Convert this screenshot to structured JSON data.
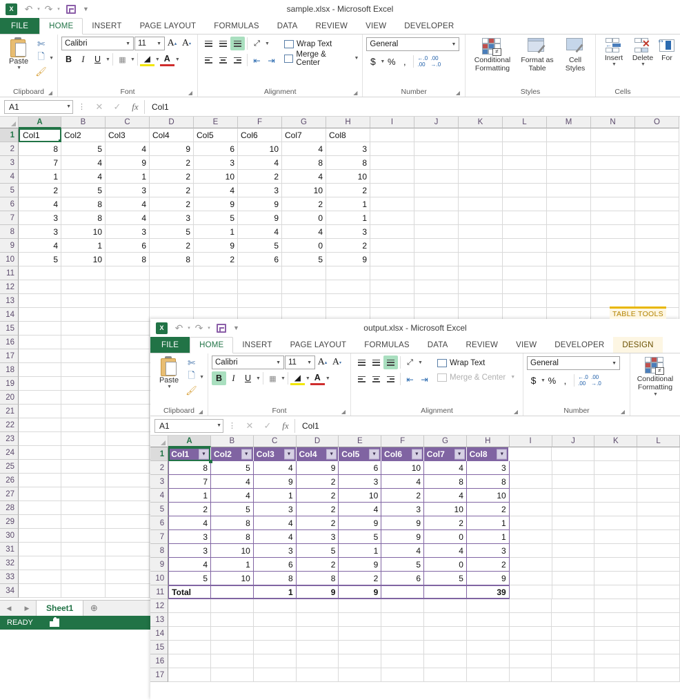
{
  "window1": {
    "title": "sample.xlsx - Microsoft Excel",
    "logo_text": "X",
    "quick_access": [
      "undo-icon",
      "redo-icon",
      "save-icon",
      "customize-icon"
    ],
    "tabs": [
      {
        "label": "FILE",
        "kind": "file"
      },
      {
        "label": "HOME",
        "kind": "active"
      },
      {
        "label": "INSERT",
        "kind": "normal"
      },
      {
        "label": "PAGE LAYOUT",
        "kind": "normal"
      },
      {
        "label": "FORMULAS",
        "kind": "normal"
      },
      {
        "label": "DATA",
        "kind": "normal"
      },
      {
        "label": "REVIEW",
        "kind": "normal"
      },
      {
        "label": "VIEW",
        "kind": "normal"
      },
      {
        "label": "DEVELOPER",
        "kind": "normal"
      }
    ],
    "ribbon": {
      "clipboard": {
        "label": "Clipboard",
        "paste": "Paste"
      },
      "font": {
        "label": "Font",
        "font_name": "Calibri",
        "font_size": "11",
        "bold": "B",
        "italic": "I",
        "underline": "U",
        "bold_active": false
      },
      "alignment": {
        "label": "Alignment",
        "wrap_text": "Wrap Text",
        "merge_center": "Merge & Center",
        "merge_disabled": false
      },
      "number": {
        "label": "Number",
        "format": "General",
        "currency": "$",
        "percent": "%",
        "comma": ","
      },
      "styles": {
        "label": "Styles",
        "conditional_formatting": "Conditional\nFormatting",
        "conditional_formatting_l1": "Conditional",
        "conditional_formatting_l2": "Formatting",
        "format_as_table_l1": "Format as",
        "format_as_table_l2": "Table",
        "cell_styles_l1": "Cell",
        "cell_styles_l2": "Styles"
      },
      "cells": {
        "label": "Cells",
        "insert": "Insert",
        "delete": "Delete",
        "format": "For"
      }
    },
    "formula_bar": {
      "name_box": "A1",
      "cancel": "✕",
      "enter": "✓",
      "fx": "fx",
      "content": "Col1"
    },
    "grid": {
      "columns": [
        "A",
        "B",
        "C",
        "D",
        "E",
        "F",
        "G",
        "H",
        "I",
        "J",
        "K",
        "L",
        "M",
        "N",
        "O"
      ],
      "selected_column": "A",
      "rows": [
        1,
        2,
        3,
        4,
        5,
        6,
        7,
        8,
        9,
        10,
        11,
        12,
        13,
        14,
        15,
        16,
        17,
        18,
        19,
        20,
        21,
        22,
        23,
        24,
        25,
        26,
        27,
        28,
        29,
        30,
        31,
        32,
        33,
        34
      ],
      "selected_row": 1,
      "active_cell": "A1"
    },
    "sheet_tabs": [
      "Sheet1"
    ],
    "status": "READY"
  },
  "window2": {
    "title": "output.xlsx - Microsoft Excel",
    "logo_text": "X",
    "context_banner": "TABLE TOOLS",
    "tabs": [
      {
        "label": "FILE",
        "kind": "file"
      },
      {
        "label": "HOME",
        "kind": "active"
      },
      {
        "label": "INSERT",
        "kind": "normal"
      },
      {
        "label": "PAGE LAYOUT",
        "kind": "normal"
      },
      {
        "label": "FORMULAS",
        "kind": "normal"
      },
      {
        "label": "DATA",
        "kind": "normal"
      },
      {
        "label": "REVIEW",
        "kind": "normal"
      },
      {
        "label": "VIEW",
        "kind": "normal"
      },
      {
        "label": "DEVELOPER",
        "kind": "normal"
      },
      {
        "label": "DESIGN",
        "kind": "ctx"
      }
    ],
    "ribbon": {
      "clipboard": {
        "label": "Clipboard",
        "paste": "Paste"
      },
      "font": {
        "label": "Font",
        "font_name": "Calibri",
        "font_size": "11",
        "bold": "B",
        "italic": "I",
        "underline": "U",
        "bold_active": true
      },
      "alignment": {
        "label": "Alignment",
        "wrap_text": "Wrap Text",
        "merge_center": "Merge & Center",
        "merge_disabled": true
      },
      "number": {
        "label": "Number",
        "format": "General",
        "currency": "$",
        "percent": "%",
        "comma": ","
      },
      "styles": {
        "conditional_formatting_l1": "Conditional",
        "conditional_formatting_l2": "Formatting"
      }
    },
    "formula_bar": {
      "name_box": "A1",
      "cancel": "✕",
      "enter": "✓",
      "fx": "fx",
      "content": "Col1"
    },
    "grid": {
      "columns": [
        "A",
        "B",
        "C",
        "D",
        "E",
        "F",
        "G",
        "H",
        "I",
        "J",
        "K",
        "L"
      ],
      "selected_column": "A",
      "rows": [
        1,
        2,
        3,
        4,
        5,
        6,
        7,
        8,
        9,
        10,
        11,
        12,
        13,
        14,
        15,
        16,
        17
      ],
      "selected_row": 1,
      "active_cell": "A1",
      "table_accent": "#8064A2"
    }
  },
  "chart_data": {
    "type": "table",
    "title": "sample.xlsx Sheet1 data",
    "columns": [
      "Col1",
      "Col2",
      "Col3",
      "Col4",
      "Col5",
      "Col6",
      "Col7",
      "Col8"
    ],
    "rows": [
      [
        8,
        5,
        4,
        9,
        6,
        10,
        4,
        3
      ],
      [
        7,
        4,
        9,
        2,
        3,
        4,
        8,
        8
      ],
      [
        1,
        4,
        1,
        2,
        10,
        2,
        4,
        10
      ],
      [
        2,
        5,
        3,
        2,
        4,
        3,
        10,
        2
      ],
      [
        4,
        8,
        4,
        2,
        9,
        9,
        2,
        1
      ],
      [
        3,
        8,
        4,
        3,
        5,
        9,
        0,
        1
      ],
      [
        3,
        10,
        3,
        5,
        1,
        4,
        4,
        3
      ],
      [
        4,
        1,
        6,
        2,
        9,
        5,
        0,
        2
      ],
      [
        5,
        10,
        8,
        8,
        2,
        6,
        5,
        9
      ]
    ],
    "total_row_label": "Total",
    "total_row": [
      "Total",
      "",
      1,
      9,
      9,
      "",
      "",
      39
    ]
  }
}
